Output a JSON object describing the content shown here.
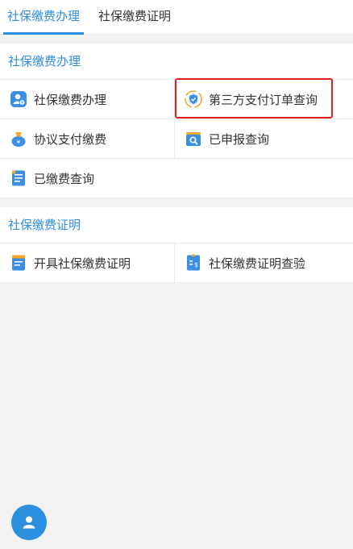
{
  "tabs": [
    {
      "label": "社保缴费办理",
      "active": true
    },
    {
      "label": "社保缴费证明",
      "active": false
    }
  ],
  "sections": [
    {
      "title": "社保缴费办理",
      "items": [
        {
          "label": "社保缴费办理",
          "icon": "person-payment-icon"
        },
        {
          "label": "第三方支付订单查询",
          "icon": "shield-check-icon",
          "highlighted": true
        },
        {
          "label": "协议支付缴费",
          "icon": "money-bag-icon"
        },
        {
          "label": "已申报查询",
          "icon": "search-folder-icon"
        },
        {
          "label": "已缴费查询",
          "icon": "document-list-icon"
        }
      ]
    },
    {
      "title": "社保缴费证明",
      "items": [
        {
          "label": "开具社保缴费证明",
          "icon": "document-issue-icon"
        },
        {
          "label": "社保缴费证明查验",
          "icon": "document-verify-icon"
        }
      ]
    }
  ],
  "colors": {
    "accent": "#2c8fe0",
    "highlight_border": "#e02020",
    "background": "#f2f2f2"
  },
  "fab": {
    "icon": "user-icon"
  }
}
